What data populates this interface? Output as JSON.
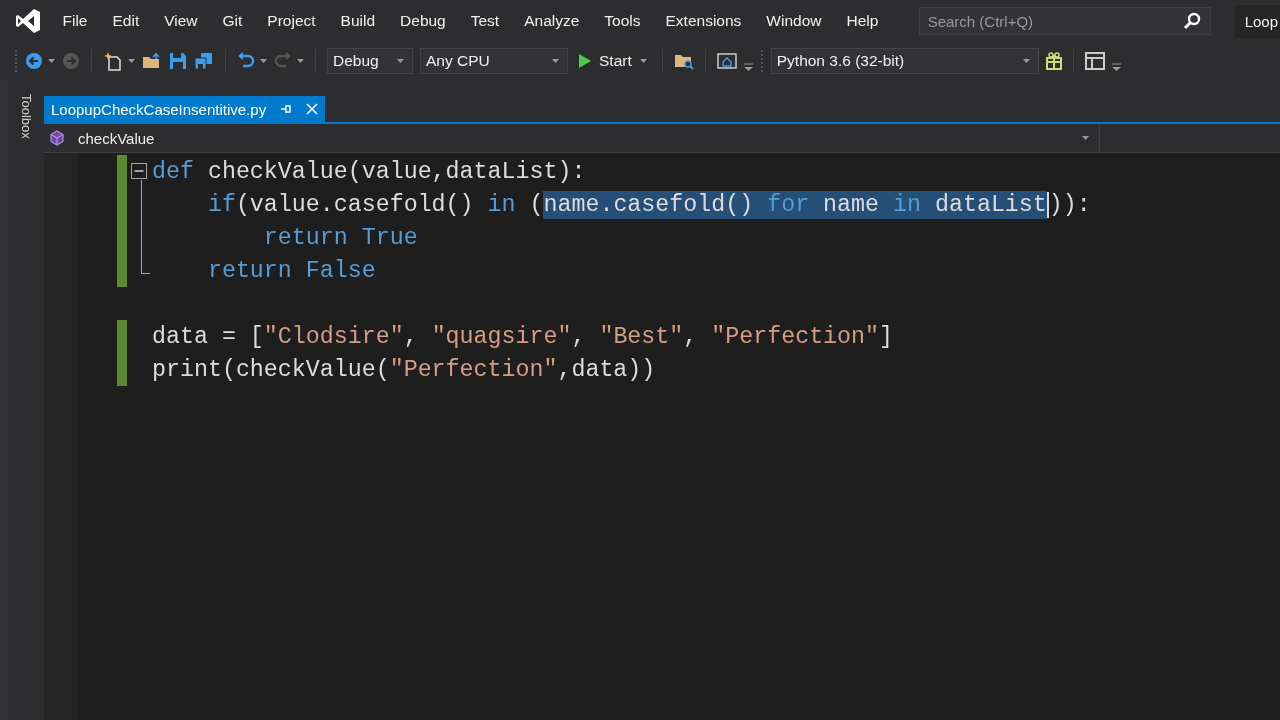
{
  "menu": [
    "File",
    "Edit",
    "View",
    "Git",
    "Project",
    "Build",
    "Debug",
    "Test",
    "Analyze",
    "Tools",
    "Extensions",
    "Window",
    "Help"
  ],
  "search": {
    "placeholder": "Search (Ctrl+Q)"
  },
  "window_title": "Loop",
  "toolbar": {
    "back": {
      "disabled": false
    },
    "forward": {
      "disabled": true
    },
    "undo": {
      "disabled": false
    },
    "redo": {
      "disabled": true
    },
    "configuration": "Debug",
    "platform": "Any CPU",
    "start": "Start",
    "environment": "Python 3.6 (32-bit)"
  },
  "side_tab": "Toolbox",
  "tabs": [
    {
      "title": "LoopupCheckCaseInsentitive.py",
      "selected": true
    }
  ],
  "navigation": {
    "member": "checkValue"
  },
  "code_blocks": [
    {
      "expanded": true,
      "lines": [
        {
          "changed": true,
          "tokens": [
            {
              "text": "def",
              "kind": "keyword"
            },
            {
              "text": " checkValue(value,dataList):",
              "kind": "plain"
            }
          ]
        },
        {
          "changed": true,
          "tokens": [
            {
              "text": "    if",
              "kind": "keyword"
            },
            {
              "text": "(value.casefold() ",
              "kind": "plain"
            },
            {
              "text": "in",
              "kind": "keyword"
            },
            {
              "text": " (",
              "kind": "plain"
            },
            {
              "text": "name.casefold() ",
              "kind": "plain",
              "selected": true
            },
            {
              "text": "for",
              "kind": "keyword",
              "selected": true
            },
            {
              "text": " name ",
              "kind": "plain",
              "selected": true
            },
            {
              "text": "in",
              "kind": "keyword",
              "selected": true
            },
            {
              "text": " dataList",
              "kind": "plain",
              "selected": true
            },
            {
              "kind": "caret"
            },
            {
              "text": ")):",
              "kind": "plain"
            }
          ]
        },
        {
          "changed": true,
          "tokens": [
            {
              "text": "        return True",
              "kind": "keyword"
            }
          ]
        },
        {
          "changed": true,
          "tokens": [
            {
              "text": "    return False",
              "kind": "keyword"
            }
          ]
        }
      ]
    },
    {
      "lines": [
        {
          "changed": true,
          "tokens": [
            {
              "text": "data = [",
              "kind": "plain"
            },
            {
              "text": "\"Clodsire\"",
              "kind": "string"
            },
            {
              "text": ", ",
              "kind": "plain"
            },
            {
              "text": "\"quagsire\"",
              "kind": "string"
            },
            {
              "text": ", ",
              "kind": "plain"
            },
            {
              "text": "\"Best\"",
              "kind": "string"
            },
            {
              "text": ", ",
              "kind": "plain"
            },
            {
              "text": "\"Perfection\"",
              "kind": "string"
            },
            {
              "text": "]",
              "kind": "plain"
            }
          ]
        },
        {
          "changed": true,
          "tokens": [
            {
              "text": "print(checkValue(",
              "kind": "plain"
            },
            {
              "text": "\"Perfection\"",
              "kind": "string"
            },
            {
              "text": ",data))",
              "kind": "plain"
            }
          ]
        }
      ]
    }
  ]
}
